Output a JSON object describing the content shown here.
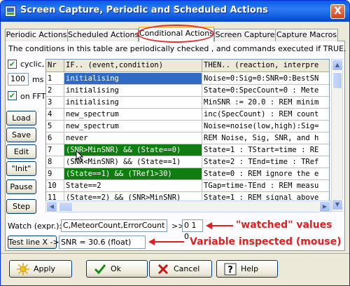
{
  "window": {
    "title": "Screen Capture, Periodic and Scheduled Actions",
    "close_label": "X"
  },
  "tabs": [
    "Periodic Actions",
    "Scheduled Actions",
    "Conditional Actions",
    "Screen Capture",
    "Capture Macros"
  ],
  "active_tab": "Conditional Actions",
  "info_text": "The conditions in this table are periodically checked , and commands executed if TRUE.",
  "left": {
    "cyclic_label": "cyclic,",
    "cyclic_checked": true,
    "interval_value": "100",
    "interval_unit": "ms",
    "onfft_label": "on FFT",
    "onfft_checked": true,
    "buttons": [
      "Load",
      "Save",
      "Edit",
      "\"Init\"",
      "Pause",
      "Step"
    ]
  },
  "table": {
    "headers": [
      "Nr",
      "IF.. (event,condition)",
      "THEN.. (reaction, interpre"
    ],
    "rows": [
      {
        "nr": "1",
        "if": "initialising",
        "then": "Noise=0:Sig=0:SNR=0:BestSN"
      },
      {
        "nr": "2",
        "if": "initialising",
        "then": "State=0:SpecCount=0 : Mete"
      },
      {
        "nr": "3",
        "if": "initialising",
        "then": "MinSNR := 20.0 : REM minim"
      },
      {
        "nr": "4",
        "if": "new_spectrum",
        "then": "inc(SpecCount) : REM count"
      },
      {
        "nr": "5",
        "if": "new_spectrum",
        "then": "Noise=noise(low,high):Sig="
      },
      {
        "nr": "6",
        "if": "never",
        "then": "REM Noise, Sig, SNR, and h"
      },
      {
        "nr": "7",
        "if": "(SNR>MinSNR) && (State==0)",
        "then": "State=1 : TStart=time : RE"
      },
      {
        "nr": "8",
        "if": "(SNR<MinSNR) && (State==1)",
        "then": "State=2 : TEnd=time : TRef"
      },
      {
        "nr": "9",
        "if": "(State==1) && (TRef1>30)",
        "then": "State=0 : REM ignore the e"
      },
      {
        "nr": "10",
        "if": "State==2",
        "then": "TGap=time-TEnd : REM measu"
      },
      {
        "nr": "11",
        "if": "(State==2) && (SNR>MinSNR)",
        "then": "State=1 : REM signal above"
      }
    ]
  },
  "watch": {
    "label": "Watch (expr.):",
    "expr": "C,MeteorCount,ErrorCount",
    "arrow": ">>",
    "output": "0 1 0"
  },
  "test": {
    "button": "Test line X ->",
    "output": "SNR = 30.6 (float)"
  },
  "annotations": {
    "watched": "\"watched\" values",
    "inspected": "Variable inspected (mouse)"
  },
  "bottom_buttons": [
    "Apply",
    "Ok",
    "Cancel",
    "Help"
  ]
}
